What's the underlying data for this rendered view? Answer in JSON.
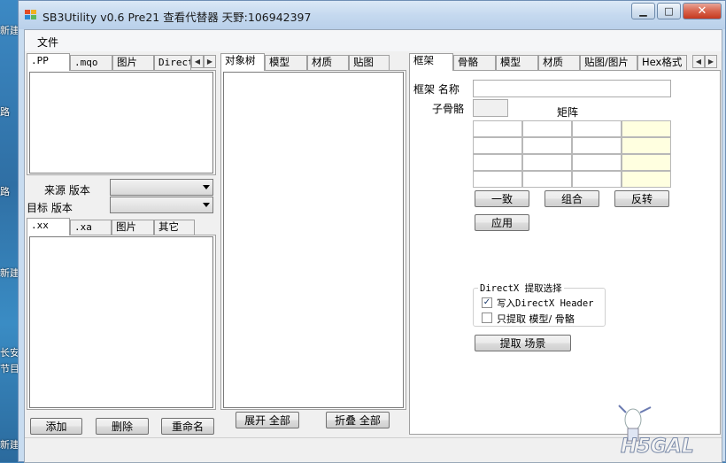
{
  "desktop": {
    "icons": [
      "新建",
      "路",
      "路",
      "新建",
      "长安",
      "节目",
      "新建"
    ]
  },
  "window": {
    "title": "SB3Utility v0.6 Pre21 查看代替器 天野:106942397",
    "controls": {
      "minimize": "▁",
      "maximize": "□",
      "close": "✕"
    }
  },
  "menubar": {
    "file": "文件"
  },
  "left_top_tabs": {
    "pp": ".PP",
    "mqo": ".mqo",
    "image": "图片",
    "directx": "DirectX"
  },
  "source_version_label": "来源 版本",
  "target_version_label": "目标 版本",
  "left_bottom_tabs": {
    "xx": ".xx",
    "xa": ".xa",
    "image": "图片",
    "other": "其它"
  },
  "left_buttons": {
    "add": "添加",
    "delete": "删除",
    "rename": "重命名"
  },
  "middle_tabs": {
    "object_tree": "对象树",
    "model": "模型",
    "material": "材质",
    "texture": "贴图"
  },
  "middle_buttons": {
    "expand_all": "展开 全部",
    "collapse_all": "折叠 全部"
  },
  "right_tabs": {
    "frame": "框架",
    "bone": "骨骼",
    "model": "模型",
    "material": "材质",
    "texture_image": "贴图/图片",
    "hex": "Hex格式"
  },
  "frame_panel": {
    "name_label": "框架 名称",
    "name_value": "",
    "child_bones_label": "子骨骼",
    "matrix_label": "矩阵",
    "btn_identity": "一致",
    "btn_combine": "组合",
    "btn_invert": "反转",
    "btn_apply": "应用"
  },
  "directx_group": {
    "title": "DirectX 提取选择",
    "write_header_label": "写入DirectX Header",
    "write_header_checked": "✓",
    "only_mesh_label": "只提取 模型/ 骨骼",
    "only_mesh_checked": ""
  },
  "extract_scene_button": "提取 场景",
  "colors": {
    "accent": "#3d7fb5",
    "matrix_highlight": "#ffffe0"
  },
  "watermark": "H5GAL"
}
